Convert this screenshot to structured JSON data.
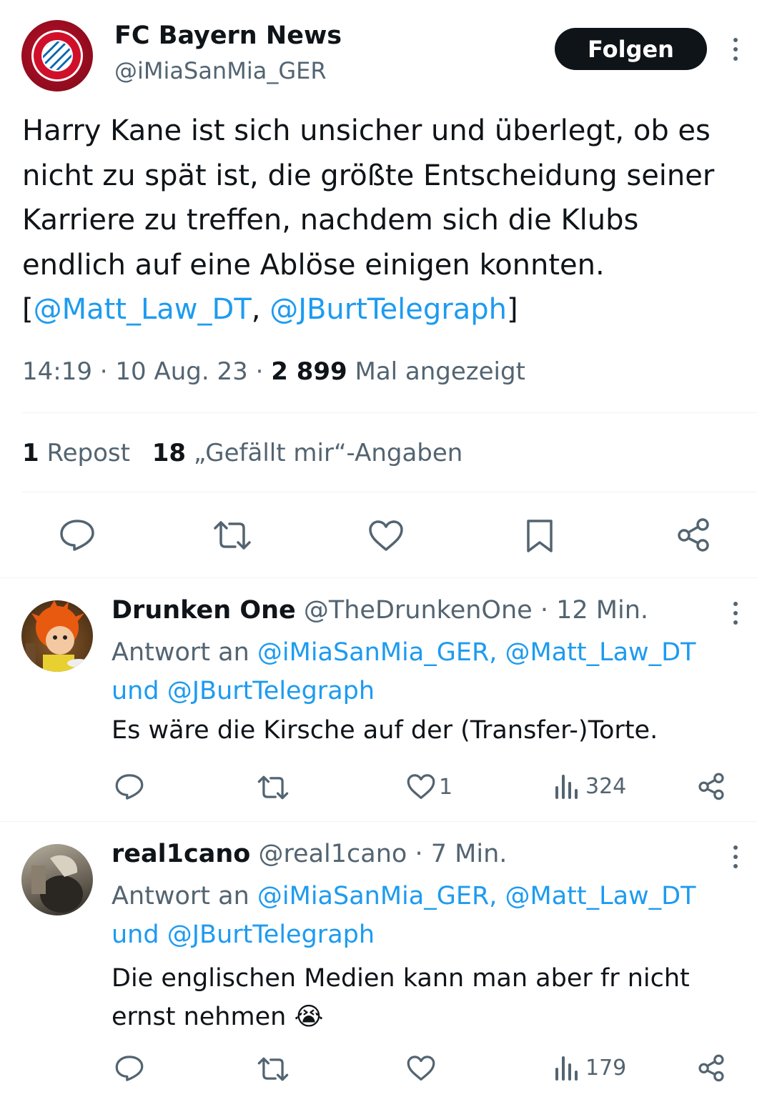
{
  "tweet": {
    "author_name": "FC Bayern News",
    "author_handle": "@iMiaSanMia_GER",
    "avatar_badge": "FC BAYERN MÜNCHEN",
    "follow_label": "Folgen",
    "text_main": "Harry Kane ist sich unsicher und überlegt, ob es nicht zu spät ist, die größte Entscheidung seiner Karriere zu treffen, nachdem sich die Klubs endlich auf eine Ablöse einigen konnten. [",
    "mention_1": "@Matt_Law_DT",
    "mention_sep": ", ",
    "mention_2": "@JBurtTelegraph",
    "text_end": "]",
    "time": "14:19",
    "date": "10 Aug. 23",
    "views_count": "2 899",
    "views_label": "Mal angezeigt",
    "reposts_count": "1",
    "reposts_label": "Repost",
    "likes_count": "18",
    "likes_label": "„Gefällt mir“-Angaben"
  },
  "replies": [
    {
      "name": "Drunken One",
      "handle": "@TheDrunkenOne",
      "time": "12 Min.",
      "reply_to_prefix": "Antwort an",
      "reply_to_line1": "@iMiaSanMia_GER, @Matt_Law_DT",
      "reply_to_and": "und",
      "reply_to_line2": "@JBurtTelegraph",
      "text": "Es wäre die Kirsche auf der (Transfer-)Torte.",
      "likes": "1",
      "views": "324"
    },
    {
      "name": "real1cano",
      "handle": "@real1cano",
      "time": "7 Min.",
      "reply_to_prefix": "Antwort an",
      "reply_to_line1": "@iMiaSanMia_GER, @Matt_Law_DT",
      "reply_to_and": "und",
      "reply_to_line2": "@JBurtTelegraph",
      "text_line1": "Die englischen Medien kann man aber fr nicht",
      "text_line2": "ernst nehmen",
      "emoji": "😭",
      "likes": "",
      "views": "179"
    }
  ],
  "separator": "·",
  "icons": [
    "reply-icon",
    "retweet-icon",
    "like-icon",
    "bookmark-icon",
    "share-icon",
    "views-icon",
    "more-icon"
  ],
  "colors": {
    "accent": "#1d9bf0",
    "secondary_text": "#536471",
    "primary_text": "#0f1419",
    "divider": "#eff3f4",
    "follow_bg": "#0f1419"
  }
}
